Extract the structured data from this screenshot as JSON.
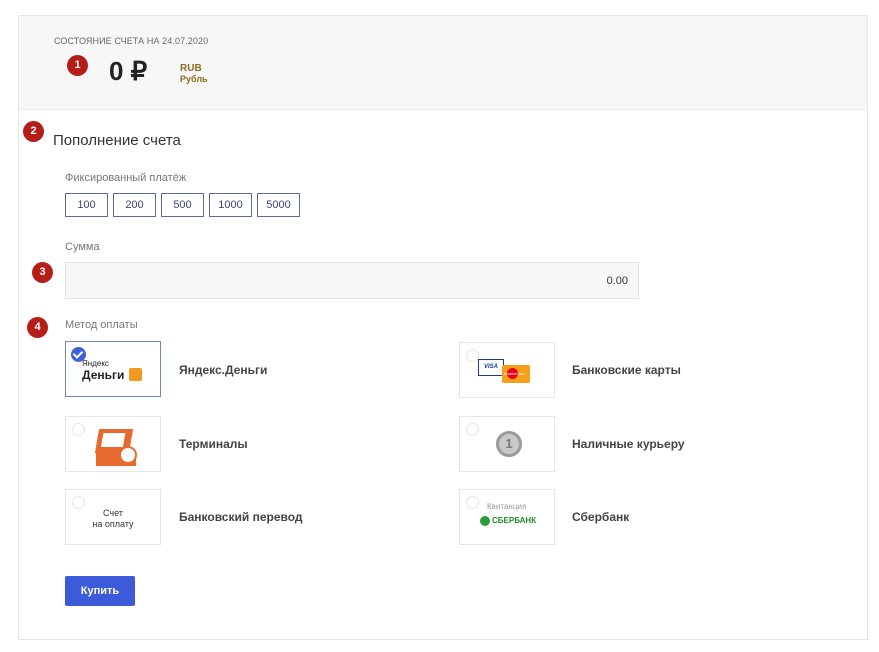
{
  "account": {
    "date_label": "СОСТОЯНИЕ СЧЕТА НА 24.07.2020",
    "amount": "0 ₽",
    "currency_code": "RUB",
    "currency_name": "Рубль"
  },
  "markers": [
    "1",
    "2",
    "3",
    "4"
  ],
  "topup": {
    "title": "Пополнение счета",
    "fixed_label": "Фиксированный платёж",
    "fixed_amounts": [
      "100",
      "200",
      "500",
      "1000",
      "5000"
    ],
    "sum_label": "Сумма",
    "sum_value": "0.00",
    "method_label": "Метод оплаты",
    "methods": [
      {
        "name": "Яндекс.Деньги",
        "selected": true,
        "logo_text": [
          "Яндекс",
          "Деньги"
        ]
      },
      {
        "name": "Банковские карты",
        "selected": false,
        "logo_text": [
          "VISA",
          "MasterCard"
        ]
      },
      {
        "name": "Терминалы",
        "selected": false
      },
      {
        "name": "Наличные курьеру",
        "selected": false,
        "logo_text": [
          "1"
        ]
      },
      {
        "name": "Банковский перевод",
        "selected": false,
        "logo_text": [
          "Счет",
          "на оплату"
        ]
      },
      {
        "name": "Сбербанк",
        "selected": false,
        "logo_text": [
          "Квитанция",
          "СБЕРБАНК"
        ]
      }
    ],
    "buy_label": "Купить"
  },
  "colors": {
    "marker": "#b41e17",
    "primary_button": "#3d5bd9",
    "selected_check": "#3d63d8",
    "currency": "#8a6d1a"
  }
}
